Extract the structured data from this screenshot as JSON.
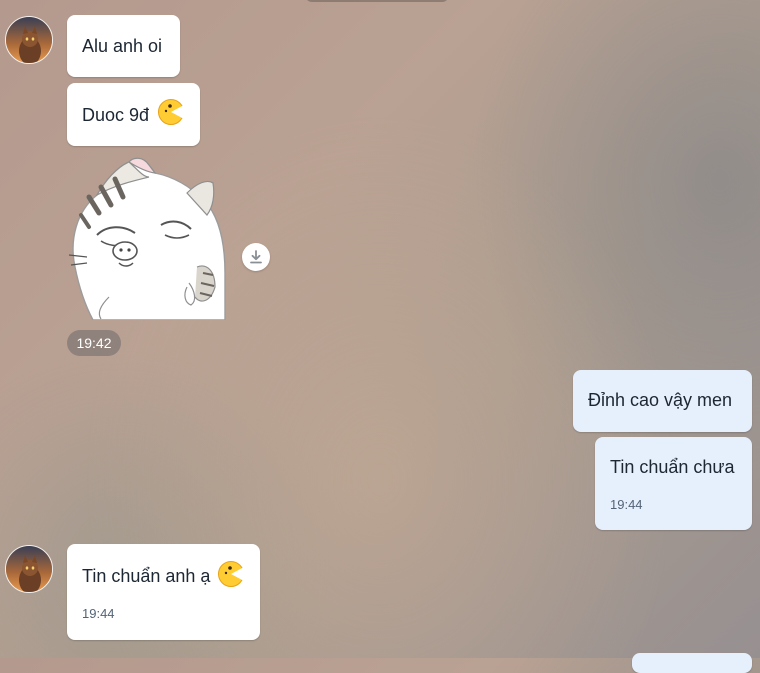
{
  "conversation": {
    "messages": [
      {
        "sender": "contact",
        "text": "Alu anh oi"
      },
      {
        "sender": "contact",
        "text": "Duoc 9đ",
        "emoji": "pacman-emoji-icon"
      },
      {
        "sender": "contact",
        "type": "sticker",
        "sticker": "cat-sticker",
        "time": "19:42"
      },
      {
        "sender": "me",
        "text": "Đỉnh cao vậy men"
      },
      {
        "sender": "me",
        "text": "Tin chuẩn chưa",
        "time": "19:44"
      },
      {
        "sender": "contact",
        "text": "Tin chuẩn anh ạ",
        "emoji": "pacman-emoji-icon",
        "time": "19:44"
      }
    ]
  },
  "colors": {
    "incoming_bubble": "#ffffff",
    "outgoing_bubble": "#e6f0fd",
    "text": "#1d2733",
    "timestamp": "#536376"
  },
  "icons": {
    "download": "download-icon",
    "emoji": "pacman-emoji-icon"
  }
}
